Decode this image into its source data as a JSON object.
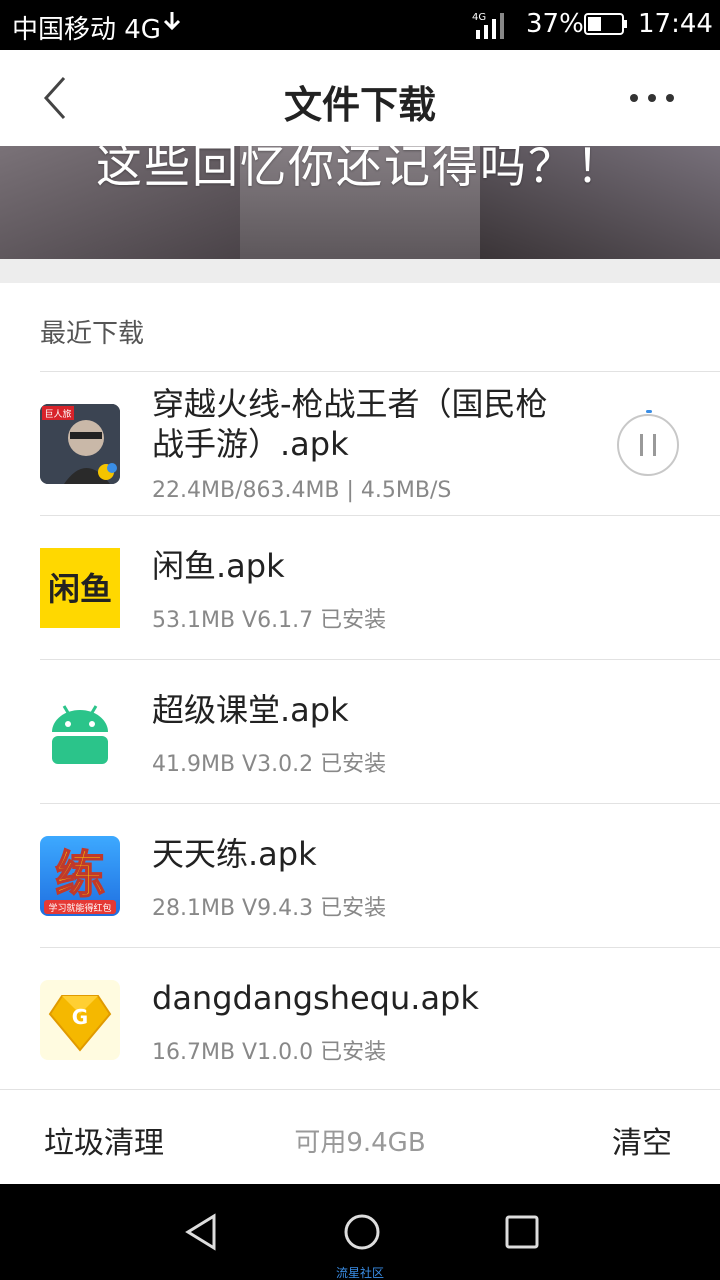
{
  "status_bar": {
    "carrier": "中国移动 4G",
    "net_type": "4G",
    "battery_percent": "37%",
    "time": "17:44"
  },
  "header": {
    "title": "文件下载"
  },
  "banner": {
    "text": "这些回忆你还记得吗？！"
  },
  "section": {
    "title": "最近下载"
  },
  "downloads": [
    {
      "name_line1": "穿越火线-枪战王者（国民枪",
      "name_line2": "战手游）.apk",
      "meta": "22.4MB/863.4MB | 4.5MB/S",
      "state": "downloading",
      "icon": "cf-game-icon",
      "icon_label": "巨人旅"
    },
    {
      "name": "闲鱼.apk",
      "meta": "53.1MB  V6.1.7 已安装",
      "icon": "xianyu-icon",
      "icon_label": "闲鱼",
      "icon_color": "#ffd800"
    },
    {
      "name": "超级课堂.apk",
      "meta": "41.9MB  V3.0.2 已安装",
      "icon": "android-icon",
      "icon_color": "#2bc48a"
    },
    {
      "name": "天天练.apk",
      "meta": "28.1MB  V9.4.3 已安装",
      "icon": "tiantianlian-icon",
      "icon_label": "练",
      "icon_sublabel": "学习就能得红包"
    },
    {
      "name": "dangdangshequ.apk",
      "meta": "16.7MB  V1.0.0 已安装",
      "icon": "dangdang-icon",
      "icon_label": "G"
    }
  ],
  "bottom_bar": {
    "clean_label": "垃圾清理",
    "storage": "可用9.4GB",
    "clear_label": "清空"
  },
  "nav_bar": {
    "watermark": "流星社区"
  }
}
